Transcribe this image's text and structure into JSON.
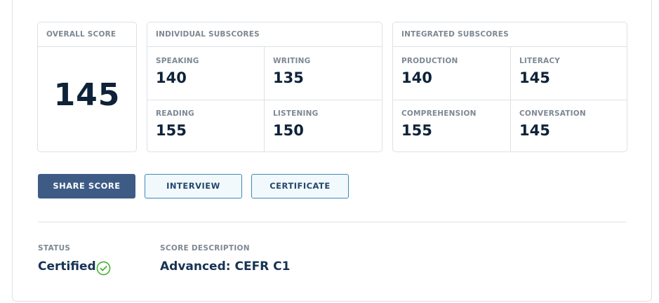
{
  "overall": {
    "label": "OVERALL SCORE",
    "value": "145"
  },
  "individual": {
    "label": "INDIVIDUAL SUBSCORES",
    "scores": [
      {
        "label": "SPEAKING",
        "value": "140"
      },
      {
        "label": "WRITING",
        "value": "135"
      },
      {
        "label": "READING",
        "value": "155"
      },
      {
        "label": "LISTENING",
        "value": "150"
      }
    ]
  },
  "integrated": {
    "label": "INTEGRATED SUBSCORES",
    "scores": [
      {
        "label": "PRODUCTION",
        "value": "140"
      },
      {
        "label": "LITERACY",
        "value": "145"
      },
      {
        "label": "COMPREHENSION",
        "value": "155"
      },
      {
        "label": "CONVERSATION",
        "value": "145"
      }
    ]
  },
  "buttons": {
    "share": "SHARE SCORE",
    "interview": "INTERVIEW",
    "certificate": "CERTIFICATE"
  },
  "status": {
    "label": "STATUS",
    "value": "Certified",
    "icon": "check-circle-icon",
    "icon_color": "#43b02a"
  },
  "score_description": {
    "label": "SCORE DESCRIPTION",
    "value": "Advanced: CEFR C1"
  },
  "colors": {
    "primary_button": "#3d5b85",
    "outline_border": "#3d8ab4",
    "score_text": "#0e2238",
    "label_text": "#7d8893"
  }
}
